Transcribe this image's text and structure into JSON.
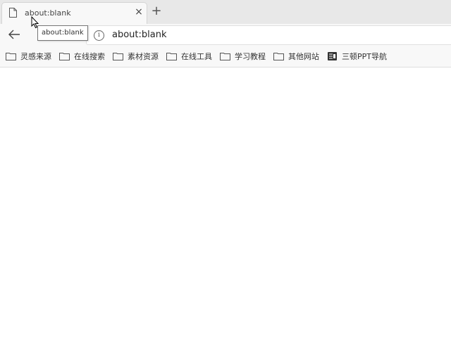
{
  "tab": {
    "title": "about:blank",
    "close": "×",
    "new_tab": "+"
  },
  "address_bar": {
    "info": "i",
    "url": "about:blank"
  },
  "tooltip": {
    "text": "about:blank"
  },
  "bookmarks": [
    {
      "label": "灵感来源",
      "icon": "folder-icon"
    },
    {
      "label": "在线搜索",
      "icon": "folder-icon"
    },
    {
      "label": "素材资源",
      "icon": "folder-icon"
    },
    {
      "label": "在线工具",
      "icon": "folder-icon"
    },
    {
      "label": "学习教程",
      "icon": "folder-icon"
    },
    {
      "label": "其他网站",
      "icon": "folder-icon"
    },
    {
      "label": "三顿PPT导航",
      "icon": "site-icon"
    }
  ],
  "colors": {
    "tabbar": "#e8e8e8",
    "toolbar": "#f8f8f8",
    "page": "#ffffff"
  }
}
